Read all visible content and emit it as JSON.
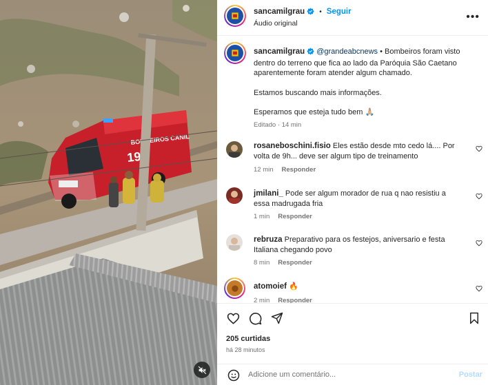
{
  "header": {
    "username": "sancamilgrau",
    "follow_label": "Seguir",
    "audio": "Áudio original",
    "separator": "•"
  },
  "caption": {
    "username": "sancamilgrau",
    "mention": "@grandeabcnews",
    "bullet": "•",
    "text_line1": "Bombeiros foram visto dentro do terreno que fica ao lado da Paróquia São Caetano aparentemente foram atender algum chamado.",
    "text_line2": "Estamos buscando mais informações.",
    "text_line3": "Esperamos que esteja tudo bem",
    "emoji": "🙏🏼",
    "edited": "Editado",
    "time": "14 min"
  },
  "comments": [
    {
      "username": "rosaneboschini.fisio",
      "text": "Eles estão desde mto cedo lá.... Por volta de 9h... deve ser algum tipo de treinamento",
      "time": "12 min",
      "reply": "Responder"
    },
    {
      "username": "jmilani_",
      "text": "Pode ser algum morador de rua q nao resistiu a essa madrugada fria",
      "time": "1 min",
      "reply": "Responder"
    },
    {
      "username": "rebruza",
      "text": "Preparativo para os festejos, aniversario e festa Italiana chegando povo",
      "time": "8 min",
      "reply": "Responder"
    },
    {
      "username": "atomoief",
      "text": "🔥",
      "time": "2 min",
      "reply": "Responder"
    }
  ],
  "media": {
    "vehicle_text_top": "BOMBEIROS CANIL",
    "vehicle_number": "19"
  },
  "actions": {
    "likes": "205 curtidas",
    "time_ago": "há 28 minutos"
  },
  "comment_box": {
    "placeholder": "Adicione um comentário...",
    "post_label": "Postar"
  },
  "colors": {
    "accent": "#0095f6",
    "verified": "#0095f6",
    "secondary_text": "#737373"
  }
}
